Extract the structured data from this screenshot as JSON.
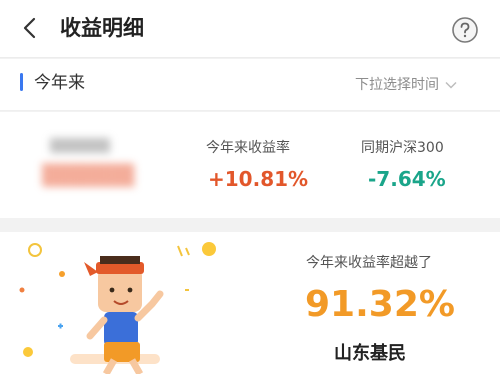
{
  "header": {
    "title": "收益明细",
    "back_icon": "chevron-left-icon",
    "help_icon": "question-circle-icon"
  },
  "period": {
    "label": "今年来",
    "picker_text": "下拉选择时间",
    "picker_icon": "chevron-down-icon"
  },
  "stats": {
    "return_label": "今年来收益率",
    "return_value": "+10.81%",
    "benchmark_label": "同期沪深300",
    "benchmark_value": "-7.64%",
    "return_color": "#e2572b",
    "benchmark_color": "#1aa58a"
  },
  "promo": {
    "label": "今年来收益率超越了",
    "percent": "91.32%",
    "group": "山东基民",
    "accent": "#f29a27"
  }
}
